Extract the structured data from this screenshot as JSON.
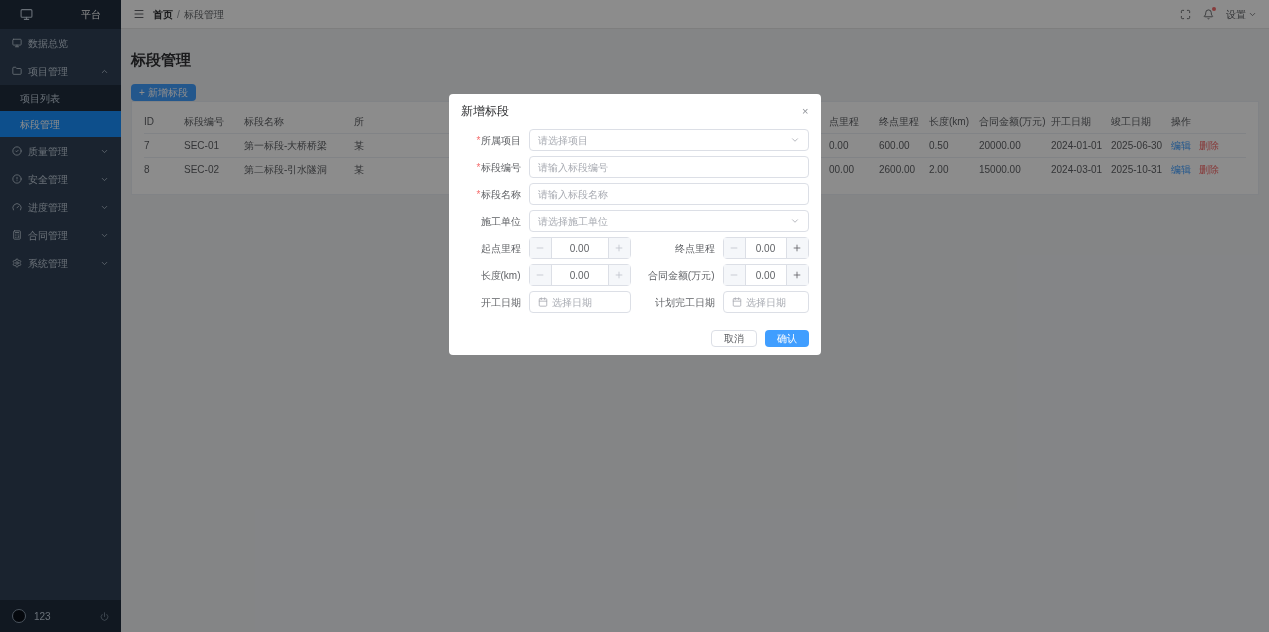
{
  "sidebar": {
    "logo_text": "平台",
    "items": [
      {
        "label": "数据总览",
        "kind": "item",
        "selected": false
      },
      {
        "label": "项目管理",
        "kind": "group",
        "expanded": true,
        "children": [
          {
            "label": "项目列表",
            "selected": false
          },
          {
            "label": "标段管理",
            "selected": true
          }
        ]
      },
      {
        "label": "质量管理",
        "kind": "group",
        "expanded": false
      },
      {
        "label": "安全管理",
        "kind": "group",
        "expanded": false
      },
      {
        "label": "进度管理",
        "kind": "group",
        "expanded": false
      },
      {
        "label": "合同管理",
        "kind": "group",
        "expanded": false
      },
      {
        "label": "系统管理",
        "kind": "group",
        "expanded": false
      }
    ],
    "user": {
      "name": "123"
    }
  },
  "header": {
    "breadcrumb": [
      "首页",
      "标段管理"
    ],
    "separator": "/",
    "notification_dot": true,
    "user_menu": "设置"
  },
  "page": {
    "title": "标段管理",
    "add_button": "+ 新增标段",
    "table": {
      "columns": [
        "ID",
        "标段编号",
        "标段名称",
        "所",
        "点里程",
        "终点里程",
        "长度(km)",
        "合同金额(万元)",
        "开工日期",
        "竣工日期",
        "操作"
      ],
      "rows": [
        {
          "cells": [
            "7",
            "SEC-01",
            "第一标段-大桥桥梁",
            "某",
            "0.00",
            "600.00",
            "0.50",
            "20000.00",
            "2024-01-01",
            "2025-06-30"
          ],
          "actions": [
            "编辑",
            "删除"
          ]
        },
        {
          "cells": [
            "8",
            "SEC-02",
            "第二标段-引水隧洞",
            "某",
            "00.00",
            "2600.00",
            "2.00",
            "15000.00",
            "2024-03-01",
            "2025-10-31"
          ],
          "actions": [
            "编辑",
            "删除"
          ]
        }
      ]
    }
  },
  "dialog": {
    "title": "新增标段",
    "close": "×",
    "required_mark": "*",
    "fields": [
      {
        "kind": "select",
        "label": "所属项目",
        "required": true,
        "placeholder": "请选择项目"
      },
      {
        "kind": "text",
        "label": "标段编号",
        "required": true,
        "placeholder": "请输入标段编号"
      },
      {
        "kind": "text",
        "label": "标段名称",
        "required": true,
        "placeholder": "请输入标段名称"
      },
      {
        "kind": "select",
        "label": "施工单位",
        "required": false,
        "placeholder": "请选择施工单位"
      }
    ],
    "pairs": [
      [
        {
          "kind": "number",
          "label": "起点里程",
          "value": "0.00",
          "minus_disabled": true,
          "plus_disabled": true
        },
        {
          "kind": "number",
          "label": "终点里程",
          "value": "0.00",
          "minus_disabled": true,
          "plus_disabled": false
        }
      ],
      [
        {
          "kind": "number",
          "label": "长度(km)",
          "value": "0.00",
          "minus_disabled": true,
          "plus_disabled": true
        },
        {
          "kind": "number",
          "label": "合同金额(万元)",
          "value": "0.00",
          "minus_disabled": true,
          "plus_disabled": false
        }
      ],
      [
        {
          "kind": "date",
          "label": "开工日期",
          "placeholder": "选择日期"
        },
        {
          "kind": "date",
          "label": "计划完工日期",
          "placeholder": "选择日期"
        }
      ]
    ],
    "buttons": [
      {
        "label": "取消",
        "primary": false
      },
      {
        "label": "确认",
        "primary": true
      }
    ]
  }
}
